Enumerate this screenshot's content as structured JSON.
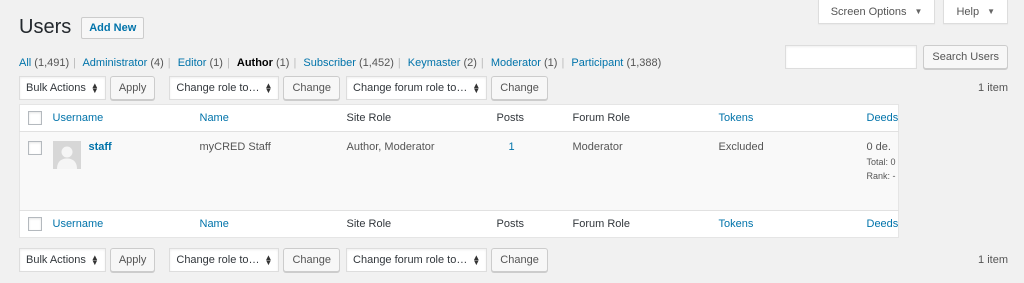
{
  "screen_options": {
    "screen_options_label": "Screen Options",
    "help_label": "Help",
    "caret": "▼"
  },
  "page": {
    "title": "Users",
    "add_new_label": "Add New"
  },
  "filters": [
    {
      "label": "All",
      "count": "(1,491)",
      "current": false
    },
    {
      "label": "Administrator",
      "count": "(4)",
      "current": false
    },
    {
      "label": "Editor",
      "count": "(1)",
      "current": false
    },
    {
      "label": "Author",
      "count": "(1)",
      "current": true
    },
    {
      "label": "Subscriber",
      "count": "(1,452)",
      "current": false
    },
    {
      "label": "Keymaster",
      "count": "(2)",
      "current": false
    },
    {
      "label": "Moderator",
      "count": "(1)",
      "current": false
    },
    {
      "label": "Participant",
      "count": "(1,388)",
      "current": false
    }
  ],
  "filter_separator": "|",
  "search": {
    "value": "",
    "button_label": "Search Users"
  },
  "tablenav": {
    "bulk_actions": "Bulk Actions",
    "apply_label": "Apply",
    "change_role": "Change role to…",
    "change_label": "Change",
    "change_forum_role": "Change forum role to…",
    "change_forum_label": "Change",
    "items_count": "1 item"
  },
  "columns": {
    "username": "Username",
    "name": "Name",
    "site_role": "Site Role",
    "posts": "Posts",
    "forum_role": "Forum Role",
    "tokens": "Tokens",
    "deeds": "Deeds"
  },
  "rows": [
    {
      "username": "staff",
      "name": "myCRED Staff",
      "site_role": "Author, Moderator",
      "posts": "1",
      "forum_role": "Moderator",
      "tokens": "Excluded",
      "deeds_value": "0 de.",
      "deeds_total": "Total: 0",
      "deeds_rank": "Rank: -"
    }
  ],
  "colors": {
    "link": "#0073aa",
    "background": "#f1f1f1"
  }
}
